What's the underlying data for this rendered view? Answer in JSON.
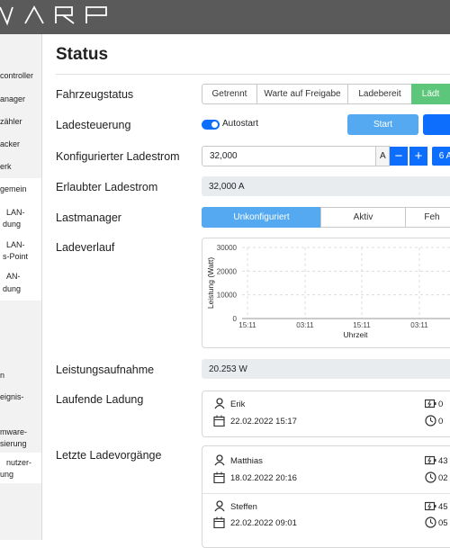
{
  "header": {
    "logo_text": "WARP"
  },
  "sidebar": {
    "items": [
      {
        "label": "controller"
      },
      {
        "label": "anager"
      },
      {
        "label": "zähler"
      },
      {
        "label": "acker"
      },
      {
        "label": "erk"
      },
      {
        "label": "gemein"
      },
      {
        "label": "LAN-"
      },
      {
        "label": "dung"
      },
      {
        "label": "LAN-"
      },
      {
        "label": "s-Point"
      },
      {
        "label": "AN-"
      },
      {
        "label": "dung"
      },
      {
        "label": "n"
      },
      {
        "label": "eignis-"
      },
      {
        "label": "mware-"
      },
      {
        "label": "sierung"
      },
      {
        "label": "nutzer-"
      },
      {
        "label": "ung"
      }
    ]
  },
  "page": {
    "title": "Status"
  },
  "vehicle_state": {
    "label": "Fahrzeugstatus",
    "options": [
      "Getrennt",
      "Warte auf Freigabe",
      "Ladebereit",
      "Lädt"
    ],
    "active": "Lädt"
  },
  "charge_control": {
    "label": "Ladesteuerung",
    "autostart_label": "Autostart",
    "autostart_on": true,
    "start_label": "Start"
  },
  "configured_current": {
    "label": "Konfigurierter Ladestrom",
    "value": "32,000",
    "unit": "A",
    "minus": "−",
    "plus": "+",
    "preset": "6 A"
  },
  "allowed_current": {
    "label": "Erlaubter Ladestrom",
    "value": "32,000 A"
  },
  "load_manager": {
    "label": "Lastmanager",
    "options": [
      "Unkonfiguriert",
      "Aktiv",
      "Feh"
    ],
    "active": "Unkonfiguriert"
  },
  "history": {
    "label": "Ladeverlauf"
  },
  "chart_data": {
    "type": "line",
    "ylabel": "Leistung (Watt)",
    "xlabel": "Uhrzeit",
    "y_ticks": [
      "30000",
      "20000",
      "10000",
      "0"
    ],
    "x_ticks": [
      "15:11",
      "03:11",
      "15:11",
      "03:11"
    ],
    "ylim": [
      0,
      30000
    ],
    "grid": true,
    "series": []
  },
  "power": {
    "label": "Leistungsaufnahme",
    "value": "20.253 W"
  },
  "current_charge": {
    "label": "Laufende Ladung",
    "user": "Erik",
    "datetime": "22.02.2022 15:17",
    "energy": "0",
    "duration": "0"
  },
  "last_charges": {
    "label": "Letzte Ladevorgänge",
    "items": [
      {
        "user": "Matthias",
        "datetime": "18.02.2022 20:16",
        "energy": "43",
        "duration": "02"
      },
      {
        "user": "Steffen",
        "datetime": "22.02.2022 09:01",
        "energy": "45",
        "duration": "05"
      }
    ]
  },
  "colors": {
    "accent": "#0d6efd",
    "active_green": "#5cc77a",
    "light_blue": "#54a9f0",
    "topbar": "#5a5a5a"
  }
}
